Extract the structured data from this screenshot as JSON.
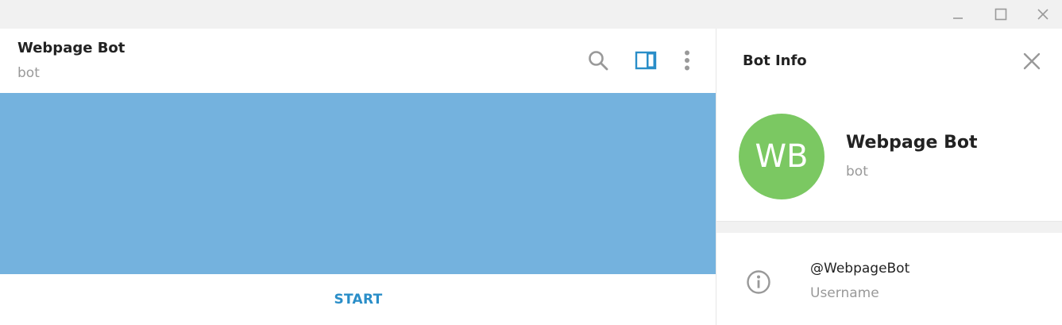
{
  "window": {
    "controls": {
      "minimize_icon": "minimize-icon",
      "maximize_icon": "maximize-icon",
      "close_icon": "close-icon"
    }
  },
  "chat": {
    "title": "Webpage Bot",
    "status": "bot",
    "header_icons": [
      "search-icon",
      "sidebar-panel-icon",
      "more-vertical-icon"
    ],
    "background_color": "#74b2de",
    "start_label": "START"
  },
  "bot_info": {
    "title": "Bot Info",
    "avatar_initials": "WB",
    "avatar_color": "#7bc862",
    "name": "Webpage Bot",
    "status": "bot",
    "username": "@WebpageBot",
    "username_label": "Username"
  },
  "colors": {
    "accent": "#2a8ec8",
    "chat_background": "#74b2de",
    "avatar": "#7bc862",
    "muted_text": "#999999",
    "primary_text": "#222222"
  }
}
